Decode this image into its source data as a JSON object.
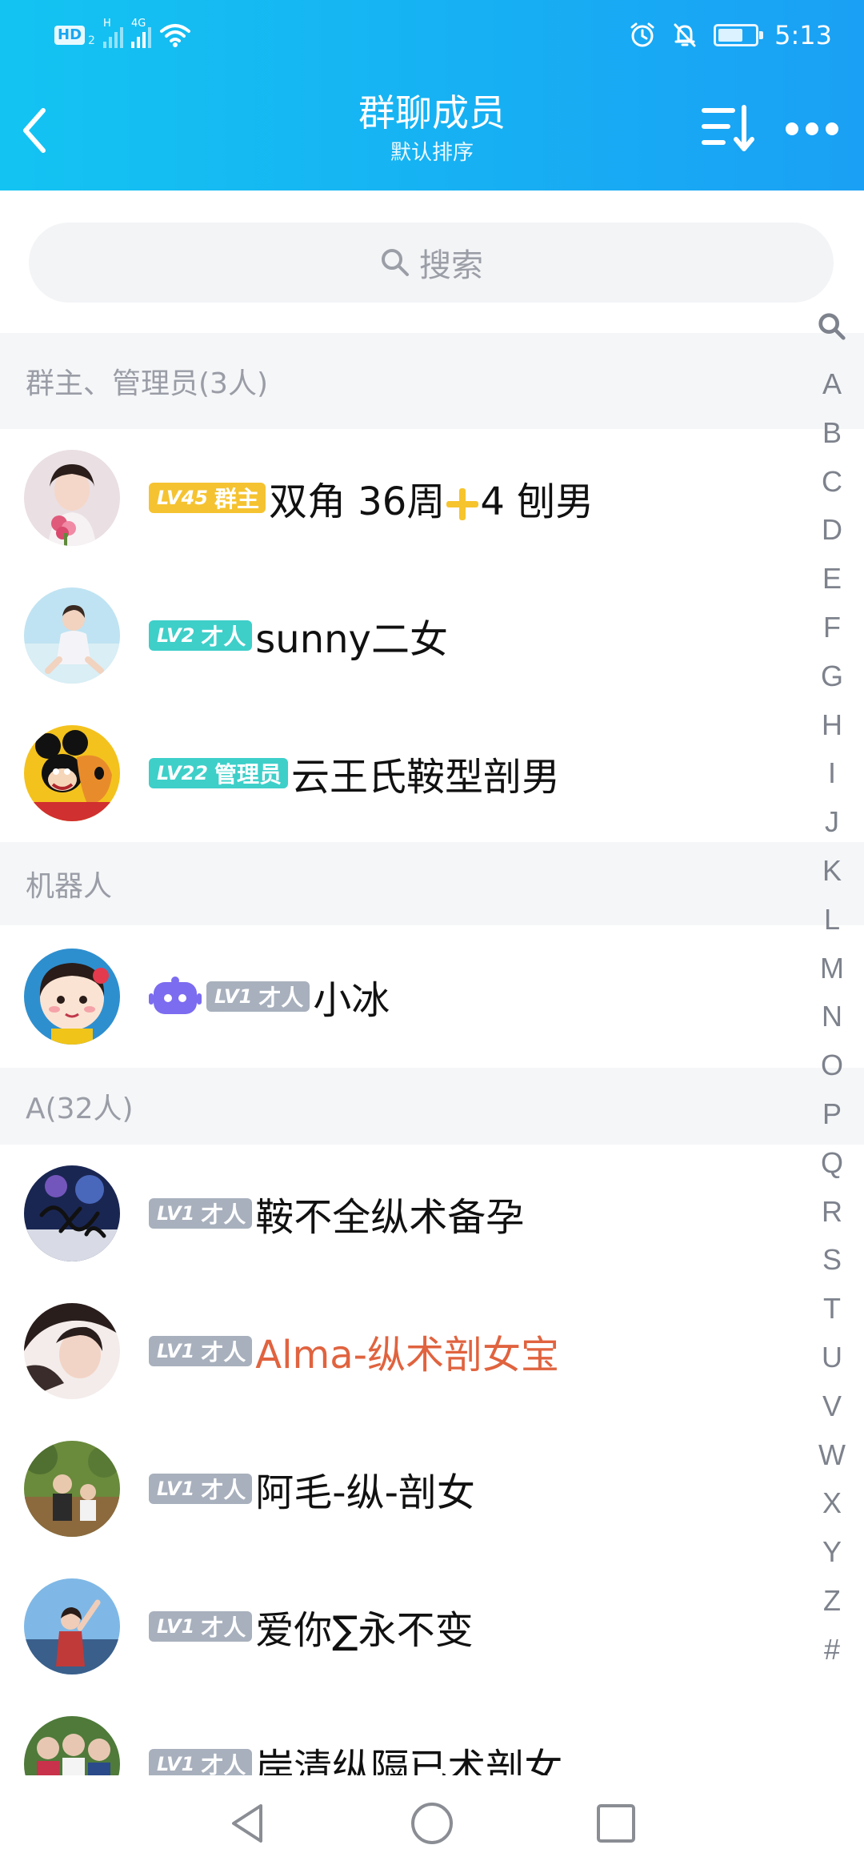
{
  "status_bar": {
    "hd_label": "HD",
    "hd_sub": "2",
    "net_h": "H",
    "net_4g": "4G",
    "time": "5:13"
  },
  "header": {
    "title": "群聊成员",
    "subtitle": "默认排序"
  },
  "search": {
    "placeholder": "搜索"
  },
  "sections": [
    {
      "title": "群主、管理员(3人)"
    },
    {
      "title": "机器人"
    },
    {
      "title": "A(32人)"
    }
  ],
  "members": [
    {
      "level": "LV45",
      "role": "群主",
      "name_a": "双角 36周",
      "name_b": "4 刨男",
      "badge_color": "#f5c331"
    },
    {
      "level": "LV2",
      "role": "才人",
      "name": "sunny二女",
      "badge_color": "#3ecfc9"
    },
    {
      "level": "LV22",
      "role": "管理员",
      "name": "云王氏鞍型剖男",
      "badge_color": "#3ecfc9"
    },
    {
      "level": "LV1",
      "role": "才人",
      "name": "小冰",
      "badge_color": "#a8b0bd"
    },
    {
      "level": "LV1",
      "role": "才人",
      "name": "鞍不全纵术备孕",
      "badge_color": "#a8b0bd"
    },
    {
      "level": "LV1",
      "role": "才人",
      "name": "Alma-纵术剖女宝",
      "badge_color": "#a8b0bd",
      "name_color": "#e0633f"
    },
    {
      "level": "LV1",
      "role": "才人",
      "name": "阿毛-纵-剖女",
      "badge_color": "#a8b0bd"
    },
    {
      "level": "LV1",
      "role": "才人",
      "name": "爱你∑永不变",
      "badge_color": "#a8b0bd"
    },
    {
      "level": "LV1",
      "role": "才人",
      "name": "岸清纵隔已术剖女",
      "badge_color": "#a8b0bd"
    }
  ],
  "index_bar": {
    "letters": [
      "A",
      "B",
      "C",
      "D",
      "E",
      "F",
      "G",
      "H",
      "I",
      "J",
      "K",
      "L",
      "M",
      "N",
      "O",
      "P",
      "Q",
      "R",
      "S",
      "T",
      "U",
      "V",
      "W",
      "X",
      "Y",
      "Z",
      "#"
    ]
  },
  "icons": {
    "back": "back-arrow-icon",
    "sort": "sort-icon",
    "more": "more-dots-icon",
    "search": "search-icon",
    "robot": "robot-icon"
  },
  "colors": {
    "header_start": "#13c4f2",
    "header_end": "#1aa0f4",
    "owner_badge": "#f5c331",
    "admin_badge": "#3ecfc9",
    "member_badge": "#a8b0bd",
    "highlight_name": "#e0633f"
  }
}
